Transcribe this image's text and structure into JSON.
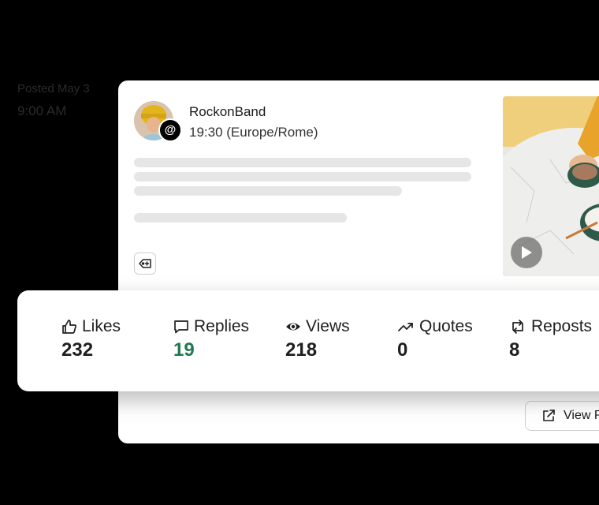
{
  "posted": {
    "label": "Posted May 3",
    "time": "9:00 AM"
  },
  "post": {
    "account_name": "RockonBand",
    "schedule_time": "19:30 (Europe/Rome)",
    "platform_icon": "threads-icon",
    "tag_icon": "tag-plus-icon",
    "media_type": "video",
    "view_button_label": "View P"
  },
  "stats": [
    {
      "icon": "thumbs-up-icon",
      "label": "Likes",
      "value": "232",
      "accent": false
    },
    {
      "icon": "comment-icon",
      "label": "Replies",
      "value": "19",
      "accent": true
    },
    {
      "icon": "eye-icon",
      "label": "Views",
      "value": "218",
      "accent": false
    },
    {
      "icon": "trending-up-icon",
      "label": "Quotes",
      "value": "0",
      "accent": false
    },
    {
      "icon": "repost-icon",
      "label": "Reposts",
      "value": "8",
      "accent": false
    }
  ],
  "colors": {
    "background": "#000000",
    "card": "#ffffff",
    "accent_green": "#1e7a4f",
    "skeleton": "#e6e6e6"
  }
}
